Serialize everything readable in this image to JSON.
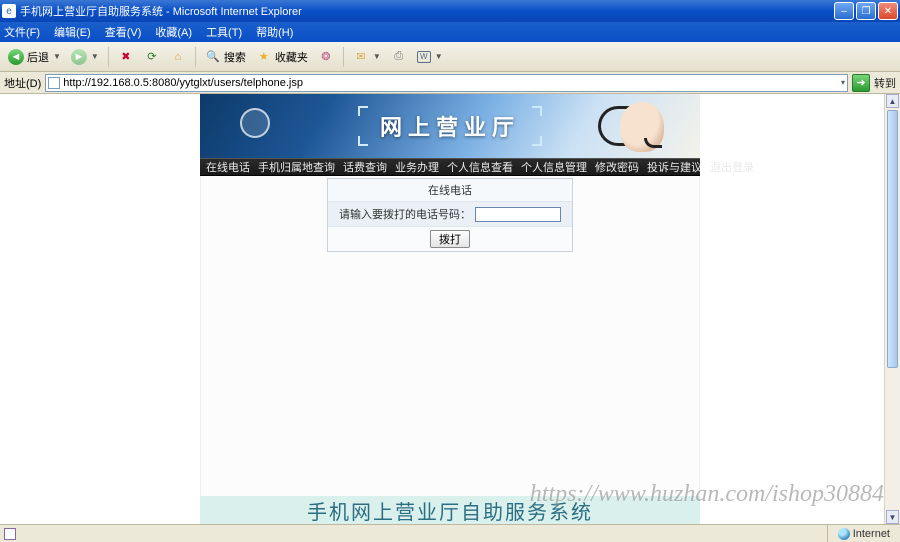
{
  "window": {
    "title": "手机网上营业厅自助服务系统 - Microsoft Internet Explorer"
  },
  "menu": {
    "file": "文件(F)",
    "edit": "编辑(E)",
    "view": "查看(V)",
    "favorites": "收藏(A)",
    "tools": "工具(T)",
    "help": "帮助(H)"
  },
  "toolbar": {
    "back": "后退",
    "search": "搜索",
    "favorites": "收藏夹"
  },
  "address": {
    "label": "地址(D)",
    "url": "http://192.168.0.5:8080/yytglxt/users/telphone.jsp",
    "go": "转到"
  },
  "banner": {
    "title": "网上营业厅"
  },
  "nav": {
    "items": [
      "在线电话",
      "手机归属地查询",
      "话费查询",
      "业务办理",
      "个人信息查看",
      "个人信息管理",
      "修改密码",
      "投诉与建议",
      "退出登录"
    ]
  },
  "form": {
    "title": "在线电话",
    "label": "请输入要拨打的电话号码：",
    "value": "",
    "submit": "拨打"
  },
  "footer": {
    "text": "手机网上营业厅自助服务系统"
  },
  "statusbar": {
    "left": "",
    "zone": "Internet"
  },
  "watermark": "https://www.huzhan.com/ishop30884"
}
